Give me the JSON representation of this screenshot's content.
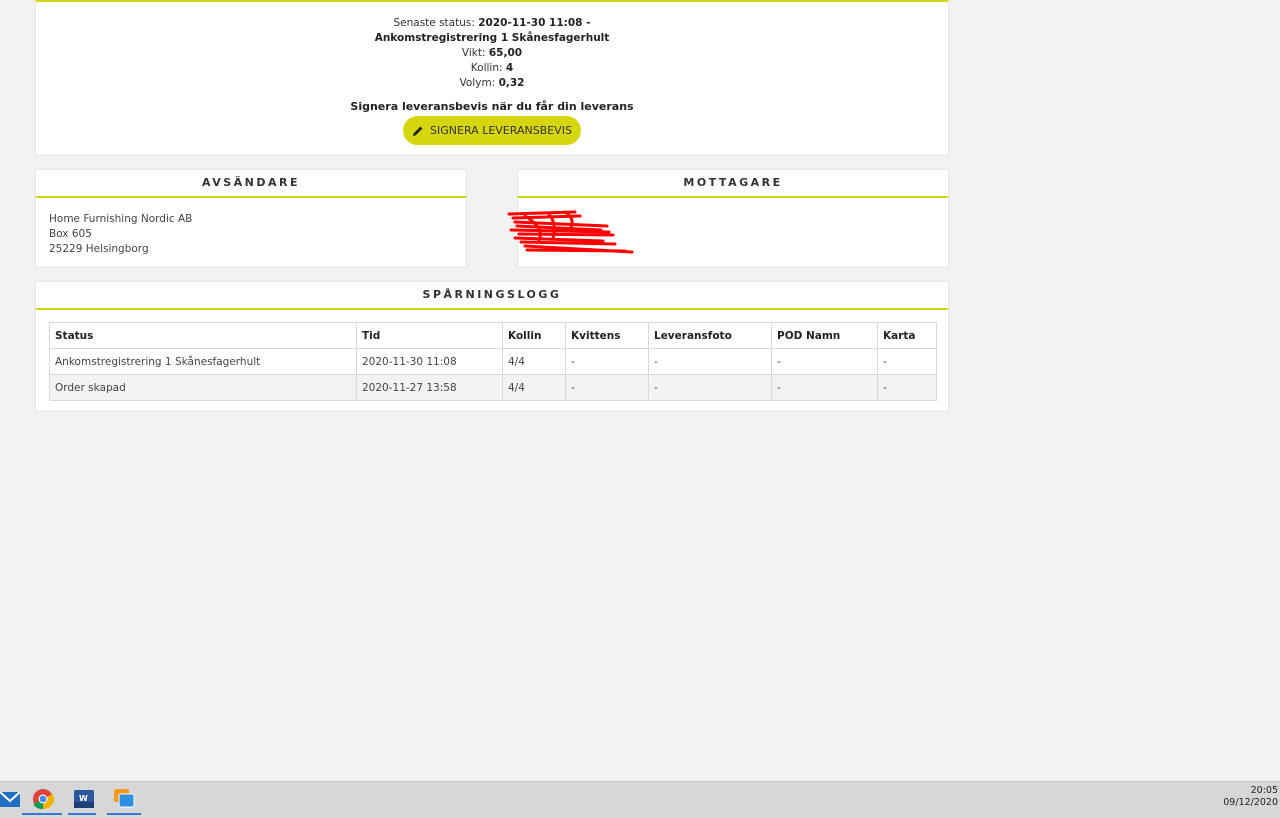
{
  "status": {
    "label": "Senaste status:",
    "datetime": "2020-11-30 11:08 -",
    "event": "Ankomstregistrering 1 Skånesfagerhult",
    "weight_label": "Vikt:",
    "weight": "65,00",
    "parcels_label": "Kollin:",
    "parcels": "4",
    "volume_label": "Volym:",
    "volume": "0,32",
    "sign_prompt": "Signera leveransbevis när du får din leverans",
    "sign_button": "SIGNERA LEVERANSBEVIS"
  },
  "sender": {
    "title": "AVSÄNDARE",
    "lines": [
      "Home Furnishing Nordic AB",
      "Box 605",
      "25229 Helsingborg"
    ]
  },
  "receiver": {
    "title": "MOTTAGARE"
  },
  "log": {
    "title": "SPÅRNINGSLOGG",
    "columns": [
      "Status",
      "Tid",
      "Kollin",
      "Kvittens",
      "Leveransfoto",
      "POD Namn",
      "Karta"
    ],
    "rows": [
      [
        "Ankomstregistrering 1 Skånesfagerhult",
        "2020-11-30 11:08",
        "4/4",
        "-",
        "-",
        "-",
        "-"
      ],
      [
        "Order skapad",
        "2020-11-27 13:58",
        "4/4",
        "-",
        "-",
        "-",
        "-"
      ]
    ]
  },
  "taskbar": {
    "apps": [
      "mail-icon",
      "chrome-icon",
      "word-icon",
      "remote-desktop-icon"
    ],
    "time": "20:05",
    "date": "09/12/2020"
  },
  "colors": {
    "accent": "#d4d40f",
    "redaction": "#ff0000"
  }
}
